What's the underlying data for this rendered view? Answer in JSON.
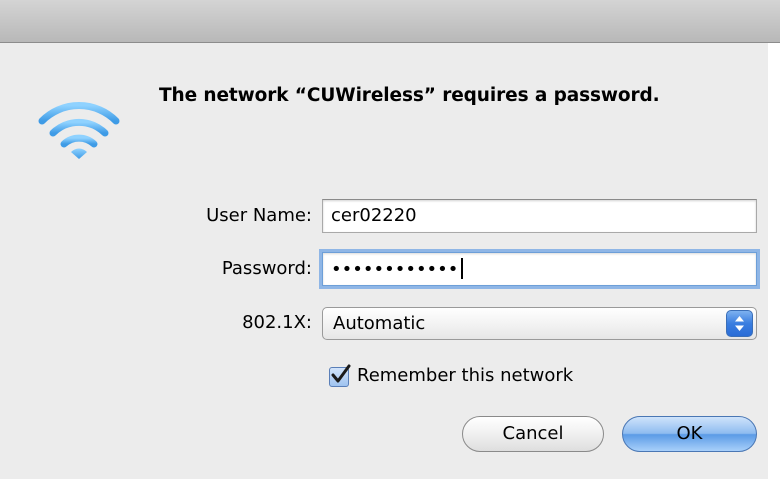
{
  "dialog": {
    "message": "The network “CUWireless” requires a password."
  },
  "form": {
    "username": {
      "label": "User Name:",
      "value": "cer02220"
    },
    "password": {
      "label": "Password:",
      "value": "••••••••••••"
    },
    "security": {
      "label": "802.1X:",
      "selected": "Automatic"
    },
    "remember": {
      "label": "Remember this network",
      "checked": true
    }
  },
  "buttons": {
    "cancel": "Cancel",
    "ok": "OK"
  },
  "icons": {
    "dialog_icon": "wifi-icon",
    "select_arrows": "up-down-arrows-icon",
    "checkbox_mark": "checkmark-icon"
  },
  "colors": {
    "wifi_blue": "#5ab0f0",
    "focus_ring": "#8fb6e6",
    "default_button": "#5b9be6"
  }
}
